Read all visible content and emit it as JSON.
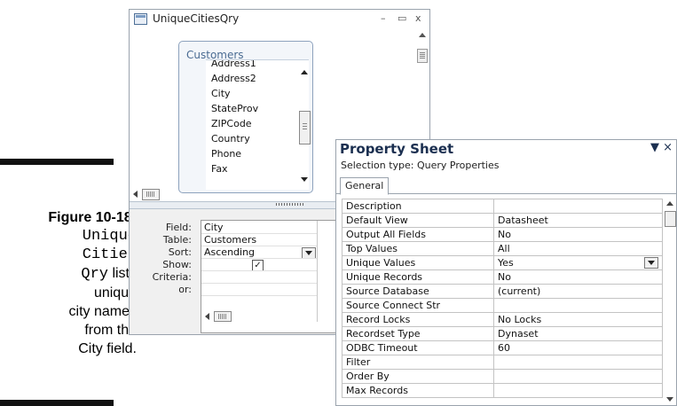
{
  "caption": {
    "title": "Figure 10-18:",
    "line1": "Unique",
    "line2": "Cities",
    "line3_mono": "Qry",
    "line3_rest": " lists",
    "line4": "unique",
    "line5": "city names",
    "line6": "from the",
    "line7": "City field."
  },
  "query_window": {
    "title": "UniqueCitiesQry",
    "minimize": "–",
    "maximize": "▭",
    "close": "x",
    "icon": "query-design-icon",
    "field_list": {
      "title": "Customers",
      "items": [
        "Address1",
        "Address2",
        "City",
        "StateProv",
        "ZIPCode",
        "Country",
        "Phone",
        "Fax"
      ]
    },
    "grid": {
      "labels": [
        "Field:",
        "Table:",
        "Sort:",
        "Show:",
        "Criteria:",
        "or:"
      ],
      "field": "City",
      "table": "Customers",
      "sort": "Ascending",
      "show": "✓"
    }
  },
  "property_sheet": {
    "title": "Property Sheet",
    "controls": "▼ ×",
    "selection_type": "Selection type:  Query Properties",
    "tab": "General",
    "rows": [
      {
        "name": "Description",
        "value": ""
      },
      {
        "name": "Default View",
        "value": "Datasheet"
      },
      {
        "name": "Output All Fields",
        "value": "No"
      },
      {
        "name": "Top Values",
        "value": "All"
      },
      {
        "name": "Unique Values",
        "value": "Yes"
      },
      {
        "name": "Unique Records",
        "value": "No"
      },
      {
        "name": "Source Database",
        "value": "(current)"
      },
      {
        "name": "Source Connect Str",
        "value": ""
      },
      {
        "name": "Record Locks",
        "value": "No Locks"
      },
      {
        "name": "Recordset Type",
        "value": "Dynaset"
      },
      {
        "name": "ODBC Timeout",
        "value": "60"
      },
      {
        "name": "Filter",
        "value": ""
      },
      {
        "name": "Order By",
        "value": ""
      },
      {
        "name": "Max Records",
        "value": ""
      }
    ]
  }
}
